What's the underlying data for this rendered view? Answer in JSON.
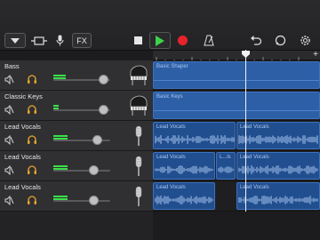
{
  "toolbar": {
    "fx_label": "FX"
  },
  "tracks": [
    {
      "name": "Bass",
      "region_labels": [
        "Basic Shaper"
      ],
      "level": 0.22,
      "volume": 0.88,
      "instrument": "piano-icon"
    },
    {
      "name": "Classic Keys",
      "region_labels": [
        "Basic Keys"
      ],
      "level": 0.1,
      "volume": 0.88,
      "instrument": "piano-icon"
    },
    {
      "name": "Lead Vocals",
      "region_labels": [
        "Lead Vocals",
        "Lead Vocals"
      ],
      "level": 0.25,
      "volume": 0.76,
      "instrument": "microphone-icon"
    },
    {
      "name": "Lead Vocals",
      "region_labels": [
        "Lead Vocals",
        "L...ls",
        "Lead Vocals"
      ],
      "level": 0.25,
      "volume": 0.7,
      "instrument": "microphone-icon"
    },
    {
      "name": "Lead Vocals",
      "region_labels": [
        "Lead Vocals",
        "Lead Vocals"
      ],
      "level": 0.25,
      "volume": 0.7,
      "instrument": "microphone-icon"
    }
  ],
  "colors": {
    "play": "#3cd34a",
    "record": "#e8232c",
    "meter": "#3adf4a",
    "solo": "#e8a52c",
    "region": "#2d5fa6"
  }
}
